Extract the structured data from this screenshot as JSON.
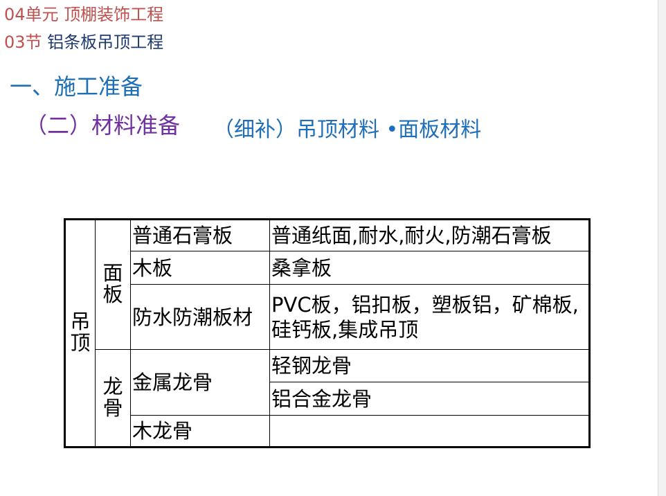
{
  "header": {
    "unit_num": "04单元",
    "unit_title": "顶棚装饰工程",
    "section_num": "03节",
    "section_title": "铝条板吊顶工程"
  },
  "heading1": "一、施工准备",
  "heading2": "（二）材料准备",
  "heading2_sub": "（细补）吊顶材料 •面板材料",
  "table": {
    "main_label": "吊顶",
    "group1_label": "面板",
    "group2_label": "龙骨",
    "rows": [
      {
        "name": "普通石膏板",
        "desc": "普通纸面,耐水,耐火,防潮石膏板"
      },
      {
        "name": "木板",
        "desc": "桑拿板"
      },
      {
        "name": "防水防潮板材",
        "desc": "PVC板，铝扣板，塑板铝，矿棉板,硅钙板,集成吊顶"
      },
      {
        "name": "金属龙骨",
        "desc": "轻钢龙骨"
      },
      {
        "desc": "铝合金龙骨"
      },
      {
        "name": "木龙骨",
        "desc": ""
      }
    ]
  }
}
